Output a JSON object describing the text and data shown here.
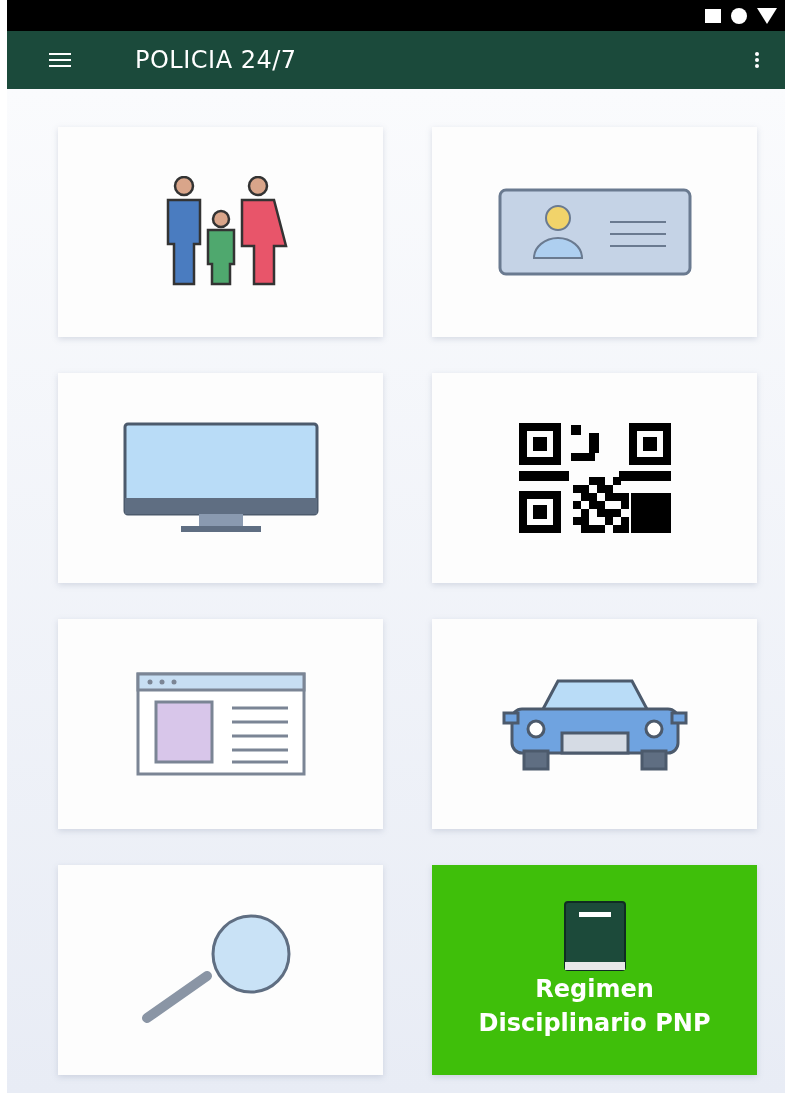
{
  "app_bar": {
    "title": "POLICIA 24/7"
  },
  "tiles": [
    {
      "kind": "family",
      "highlighted": false
    },
    {
      "kind": "id-card",
      "highlighted": false
    },
    {
      "kind": "monitor",
      "highlighted": false
    },
    {
      "kind": "qr",
      "highlighted": false
    },
    {
      "kind": "web-page",
      "highlighted": false
    },
    {
      "kind": "car",
      "highlighted": false
    },
    {
      "kind": "search",
      "highlighted": false
    },
    {
      "kind": "book",
      "highlighted": true,
      "label": "Regimen Disciplinario PNP"
    }
  ]
}
